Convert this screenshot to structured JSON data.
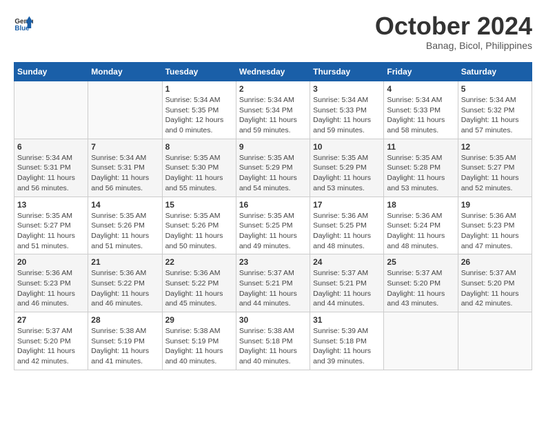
{
  "header": {
    "logo": {
      "line1": "General",
      "line2": "Blue"
    },
    "title": "October 2024",
    "subtitle": "Banag, Bicol, Philippines"
  },
  "weekdays": [
    "Sunday",
    "Monday",
    "Tuesday",
    "Wednesday",
    "Thursday",
    "Friday",
    "Saturday"
  ],
  "weeks": [
    [
      {
        "day": "",
        "info": ""
      },
      {
        "day": "",
        "info": ""
      },
      {
        "day": "1",
        "info": "Sunrise: 5:34 AM\nSunset: 5:35 PM\nDaylight: 12 hours\nand 0 minutes."
      },
      {
        "day": "2",
        "info": "Sunrise: 5:34 AM\nSunset: 5:34 PM\nDaylight: 11 hours\nand 59 minutes."
      },
      {
        "day": "3",
        "info": "Sunrise: 5:34 AM\nSunset: 5:33 PM\nDaylight: 11 hours\nand 59 minutes."
      },
      {
        "day": "4",
        "info": "Sunrise: 5:34 AM\nSunset: 5:33 PM\nDaylight: 11 hours\nand 58 minutes."
      },
      {
        "day": "5",
        "info": "Sunrise: 5:34 AM\nSunset: 5:32 PM\nDaylight: 11 hours\nand 57 minutes."
      }
    ],
    [
      {
        "day": "6",
        "info": "Sunrise: 5:34 AM\nSunset: 5:31 PM\nDaylight: 11 hours\nand 56 minutes."
      },
      {
        "day": "7",
        "info": "Sunrise: 5:34 AM\nSunset: 5:31 PM\nDaylight: 11 hours\nand 56 minutes."
      },
      {
        "day": "8",
        "info": "Sunrise: 5:35 AM\nSunset: 5:30 PM\nDaylight: 11 hours\nand 55 minutes."
      },
      {
        "day": "9",
        "info": "Sunrise: 5:35 AM\nSunset: 5:29 PM\nDaylight: 11 hours\nand 54 minutes."
      },
      {
        "day": "10",
        "info": "Sunrise: 5:35 AM\nSunset: 5:29 PM\nDaylight: 11 hours\nand 53 minutes."
      },
      {
        "day": "11",
        "info": "Sunrise: 5:35 AM\nSunset: 5:28 PM\nDaylight: 11 hours\nand 53 minutes."
      },
      {
        "day": "12",
        "info": "Sunrise: 5:35 AM\nSunset: 5:27 PM\nDaylight: 11 hours\nand 52 minutes."
      }
    ],
    [
      {
        "day": "13",
        "info": "Sunrise: 5:35 AM\nSunset: 5:27 PM\nDaylight: 11 hours\nand 51 minutes."
      },
      {
        "day": "14",
        "info": "Sunrise: 5:35 AM\nSunset: 5:26 PM\nDaylight: 11 hours\nand 51 minutes."
      },
      {
        "day": "15",
        "info": "Sunrise: 5:35 AM\nSunset: 5:26 PM\nDaylight: 11 hours\nand 50 minutes."
      },
      {
        "day": "16",
        "info": "Sunrise: 5:35 AM\nSunset: 5:25 PM\nDaylight: 11 hours\nand 49 minutes."
      },
      {
        "day": "17",
        "info": "Sunrise: 5:36 AM\nSunset: 5:25 PM\nDaylight: 11 hours\nand 48 minutes."
      },
      {
        "day": "18",
        "info": "Sunrise: 5:36 AM\nSunset: 5:24 PM\nDaylight: 11 hours\nand 48 minutes."
      },
      {
        "day": "19",
        "info": "Sunrise: 5:36 AM\nSunset: 5:23 PM\nDaylight: 11 hours\nand 47 minutes."
      }
    ],
    [
      {
        "day": "20",
        "info": "Sunrise: 5:36 AM\nSunset: 5:23 PM\nDaylight: 11 hours\nand 46 minutes."
      },
      {
        "day": "21",
        "info": "Sunrise: 5:36 AM\nSunset: 5:22 PM\nDaylight: 11 hours\nand 46 minutes."
      },
      {
        "day": "22",
        "info": "Sunrise: 5:36 AM\nSunset: 5:22 PM\nDaylight: 11 hours\nand 45 minutes."
      },
      {
        "day": "23",
        "info": "Sunrise: 5:37 AM\nSunset: 5:21 PM\nDaylight: 11 hours\nand 44 minutes."
      },
      {
        "day": "24",
        "info": "Sunrise: 5:37 AM\nSunset: 5:21 PM\nDaylight: 11 hours\nand 44 minutes."
      },
      {
        "day": "25",
        "info": "Sunrise: 5:37 AM\nSunset: 5:20 PM\nDaylight: 11 hours\nand 43 minutes."
      },
      {
        "day": "26",
        "info": "Sunrise: 5:37 AM\nSunset: 5:20 PM\nDaylight: 11 hours\nand 42 minutes."
      }
    ],
    [
      {
        "day": "27",
        "info": "Sunrise: 5:37 AM\nSunset: 5:20 PM\nDaylight: 11 hours\nand 42 minutes."
      },
      {
        "day": "28",
        "info": "Sunrise: 5:38 AM\nSunset: 5:19 PM\nDaylight: 11 hours\nand 41 minutes."
      },
      {
        "day": "29",
        "info": "Sunrise: 5:38 AM\nSunset: 5:19 PM\nDaylight: 11 hours\nand 40 minutes."
      },
      {
        "day": "30",
        "info": "Sunrise: 5:38 AM\nSunset: 5:18 PM\nDaylight: 11 hours\nand 40 minutes."
      },
      {
        "day": "31",
        "info": "Sunrise: 5:39 AM\nSunset: 5:18 PM\nDaylight: 11 hours\nand 39 minutes."
      },
      {
        "day": "",
        "info": ""
      },
      {
        "day": "",
        "info": ""
      }
    ]
  ]
}
